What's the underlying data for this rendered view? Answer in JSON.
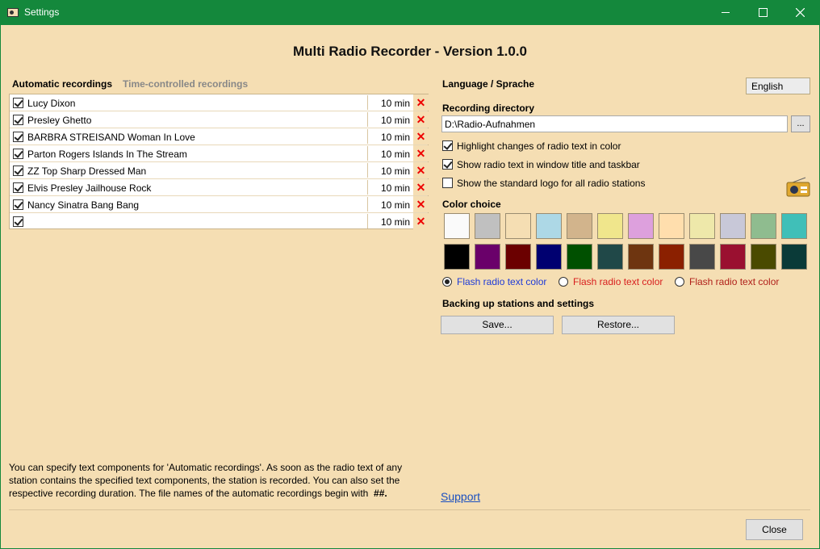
{
  "window": {
    "title": "Settings"
  },
  "header": {
    "title": "Multi Radio Recorder - Version 1.0.0"
  },
  "tabs": [
    "Automatic recordings",
    "Time-controlled recordings"
  ],
  "recordings": [
    {
      "name": "Lucy Dixon",
      "duration": "10 min",
      "checked": true
    },
    {
      "name": "Presley Ghetto",
      "duration": "10 min",
      "checked": true
    },
    {
      "name": "BARBRA STREISAND Woman In Love",
      "duration": "10 min",
      "checked": true
    },
    {
      "name": "Parton Rogers Islands In The Stream",
      "duration": "10 min",
      "checked": true
    },
    {
      "name": "ZZ Top Sharp Dressed Man",
      "duration": "10 min",
      "checked": true
    },
    {
      "name": "Elvis Presley Jailhouse Rock",
      "duration": "10 min",
      "checked": true
    },
    {
      "name": "Nancy Sinatra Bang Bang",
      "duration": "10 min",
      "checked": true
    },
    {
      "name": "",
      "duration": "10 min",
      "checked": true
    }
  ],
  "delete_glyph": "✕",
  "language": {
    "label": "Language / Sprache",
    "selected": "English"
  },
  "directory": {
    "label": "Recording directory",
    "value": "D:\\Radio-Aufnahmen",
    "browse_label": "..."
  },
  "options": [
    {
      "label": "Highlight changes of radio text in color",
      "checked": true
    },
    {
      "label": "Show radio text in window title and taskbar",
      "checked": true
    },
    {
      "label": "Show the standard logo for all radio stations",
      "checked": false
    }
  ],
  "color_choice": {
    "label": "Color choice",
    "row1": [
      "#fafafa",
      "#c0c0c0",
      "#f5deb3",
      "#add8e6",
      "#d2b48c",
      "#f0e68c",
      "#dda0dd",
      "#ffdead",
      "#eee8aa",
      "#c8c8d8",
      "#8fbc8f",
      "#40bfb8"
    ],
    "row2": [
      "#000000",
      "#6a006a",
      "#6b0000",
      "#000070",
      "#005000",
      "#204848",
      "#6e3510",
      "#8b2000",
      "#484848",
      "#9a1030",
      "#4a4a00",
      "#0a3a38"
    ]
  },
  "flash_options": [
    {
      "label": "Flash radio text color",
      "selected": true,
      "color": "#1e3ad8"
    },
    {
      "label": "Flash radio text color",
      "selected": false,
      "color": "#d81e1e"
    },
    {
      "label": "Flash radio text color",
      "selected": false,
      "color": "#b0201a"
    }
  ],
  "backup": {
    "label": "Backing up stations and settings",
    "save_label": "Save...",
    "restore_label": "Restore..."
  },
  "info": {
    "text": "You can specify text components for 'Automatic recordings'. As soon as the radio text of any station contains the specified text components, the station is recorded. You can also set the respective recording duration. The file names of the automatic recordings begin with",
    "prefix": "##."
  },
  "support_label": "Support",
  "close_label": "Close",
  "icons": {
    "app": "radio-icon",
    "minimize": "minimize-icon",
    "maximize": "maximize-icon",
    "close": "close-icon"
  }
}
